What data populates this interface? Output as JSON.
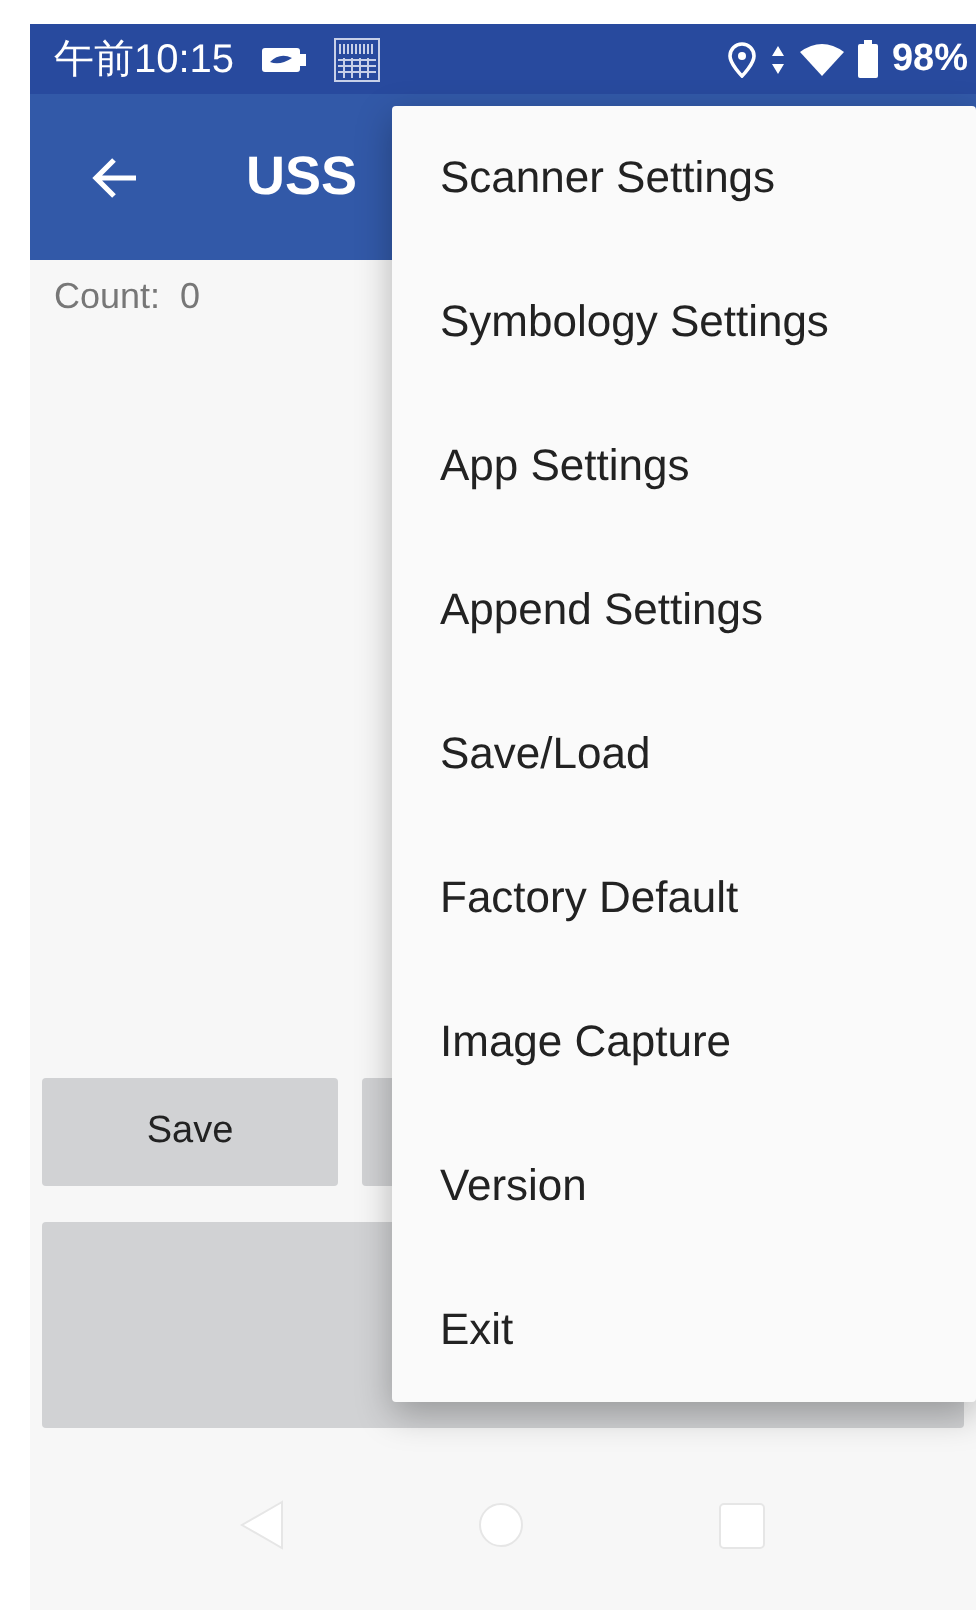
{
  "status_bar": {
    "time": "午前10:15",
    "battery": "98%"
  },
  "app_bar": {
    "title": "USS"
  },
  "content": {
    "count_label": "Count:",
    "count_value": "0",
    "buttons": [
      "Save"
    ]
  },
  "menu": {
    "items": [
      {
        "label": "Scanner Settings"
      },
      {
        "label": "Symbology Settings"
      },
      {
        "label": "App Settings"
      },
      {
        "label": "Append Settings"
      },
      {
        "label": "Save/Load"
      },
      {
        "label": "Factory Default"
      },
      {
        "label": "Image Capture"
      },
      {
        "label": "Version"
      },
      {
        "label": "Exit"
      }
    ]
  }
}
